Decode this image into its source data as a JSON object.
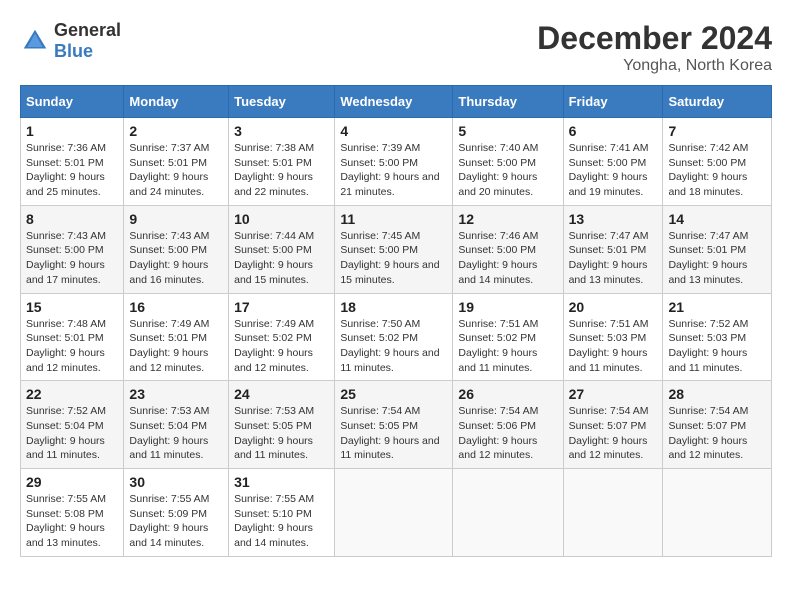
{
  "logo": {
    "general": "General",
    "blue": "Blue"
  },
  "title": "December 2024",
  "location": "Yongha, North Korea",
  "days_of_week": [
    "Sunday",
    "Monday",
    "Tuesday",
    "Wednesday",
    "Thursday",
    "Friday",
    "Saturday"
  ],
  "weeks": [
    [
      {
        "date": "1",
        "sunrise": "7:36 AM",
        "sunset": "5:01 PM",
        "daylight": "9 hours and 25 minutes."
      },
      {
        "date": "2",
        "sunrise": "7:37 AM",
        "sunset": "5:01 PM",
        "daylight": "9 hours and 24 minutes."
      },
      {
        "date": "3",
        "sunrise": "7:38 AM",
        "sunset": "5:01 PM",
        "daylight": "9 hours and 22 minutes."
      },
      {
        "date": "4",
        "sunrise": "7:39 AM",
        "sunset": "5:00 PM",
        "daylight": "9 hours and 21 minutes."
      },
      {
        "date": "5",
        "sunrise": "7:40 AM",
        "sunset": "5:00 PM",
        "daylight": "9 hours and 20 minutes."
      },
      {
        "date": "6",
        "sunrise": "7:41 AM",
        "sunset": "5:00 PM",
        "daylight": "9 hours and 19 minutes."
      },
      {
        "date": "7",
        "sunrise": "7:42 AM",
        "sunset": "5:00 PM",
        "daylight": "9 hours and 18 minutes."
      }
    ],
    [
      {
        "date": "8",
        "sunrise": "7:43 AM",
        "sunset": "5:00 PM",
        "daylight": "9 hours and 17 minutes."
      },
      {
        "date": "9",
        "sunrise": "7:43 AM",
        "sunset": "5:00 PM",
        "daylight": "9 hours and 16 minutes."
      },
      {
        "date": "10",
        "sunrise": "7:44 AM",
        "sunset": "5:00 PM",
        "daylight": "9 hours and 15 minutes."
      },
      {
        "date": "11",
        "sunrise": "7:45 AM",
        "sunset": "5:00 PM",
        "daylight": "9 hours and 15 minutes."
      },
      {
        "date": "12",
        "sunrise": "7:46 AM",
        "sunset": "5:00 PM",
        "daylight": "9 hours and 14 minutes."
      },
      {
        "date": "13",
        "sunrise": "7:47 AM",
        "sunset": "5:01 PM",
        "daylight": "9 hours and 13 minutes."
      },
      {
        "date": "14",
        "sunrise": "7:47 AM",
        "sunset": "5:01 PM",
        "daylight": "9 hours and 13 minutes."
      }
    ],
    [
      {
        "date": "15",
        "sunrise": "7:48 AM",
        "sunset": "5:01 PM",
        "daylight": "9 hours and 12 minutes."
      },
      {
        "date": "16",
        "sunrise": "7:49 AM",
        "sunset": "5:01 PM",
        "daylight": "9 hours and 12 minutes."
      },
      {
        "date": "17",
        "sunrise": "7:49 AM",
        "sunset": "5:02 PM",
        "daylight": "9 hours and 12 minutes."
      },
      {
        "date": "18",
        "sunrise": "7:50 AM",
        "sunset": "5:02 PM",
        "daylight": "9 hours and 11 minutes."
      },
      {
        "date": "19",
        "sunrise": "7:51 AM",
        "sunset": "5:02 PM",
        "daylight": "9 hours and 11 minutes."
      },
      {
        "date": "20",
        "sunrise": "7:51 AM",
        "sunset": "5:03 PM",
        "daylight": "9 hours and 11 minutes."
      },
      {
        "date": "21",
        "sunrise": "7:52 AM",
        "sunset": "5:03 PM",
        "daylight": "9 hours and 11 minutes."
      }
    ],
    [
      {
        "date": "22",
        "sunrise": "7:52 AM",
        "sunset": "5:04 PM",
        "daylight": "9 hours and 11 minutes."
      },
      {
        "date": "23",
        "sunrise": "7:53 AM",
        "sunset": "5:04 PM",
        "daylight": "9 hours and 11 minutes."
      },
      {
        "date": "24",
        "sunrise": "7:53 AM",
        "sunset": "5:05 PM",
        "daylight": "9 hours and 11 minutes."
      },
      {
        "date": "25",
        "sunrise": "7:54 AM",
        "sunset": "5:05 PM",
        "daylight": "9 hours and 11 minutes."
      },
      {
        "date": "26",
        "sunrise": "7:54 AM",
        "sunset": "5:06 PM",
        "daylight": "9 hours and 12 minutes."
      },
      {
        "date": "27",
        "sunrise": "7:54 AM",
        "sunset": "5:07 PM",
        "daylight": "9 hours and 12 minutes."
      },
      {
        "date": "28",
        "sunrise": "7:54 AM",
        "sunset": "5:07 PM",
        "daylight": "9 hours and 12 minutes."
      }
    ],
    [
      {
        "date": "29",
        "sunrise": "7:55 AM",
        "sunset": "5:08 PM",
        "daylight": "9 hours and 13 minutes."
      },
      {
        "date": "30",
        "sunrise": "7:55 AM",
        "sunset": "5:09 PM",
        "daylight": "9 hours and 14 minutes."
      },
      {
        "date": "31",
        "sunrise": "7:55 AM",
        "sunset": "5:10 PM",
        "daylight": "9 hours and 14 minutes."
      },
      null,
      null,
      null,
      null
    ]
  ]
}
